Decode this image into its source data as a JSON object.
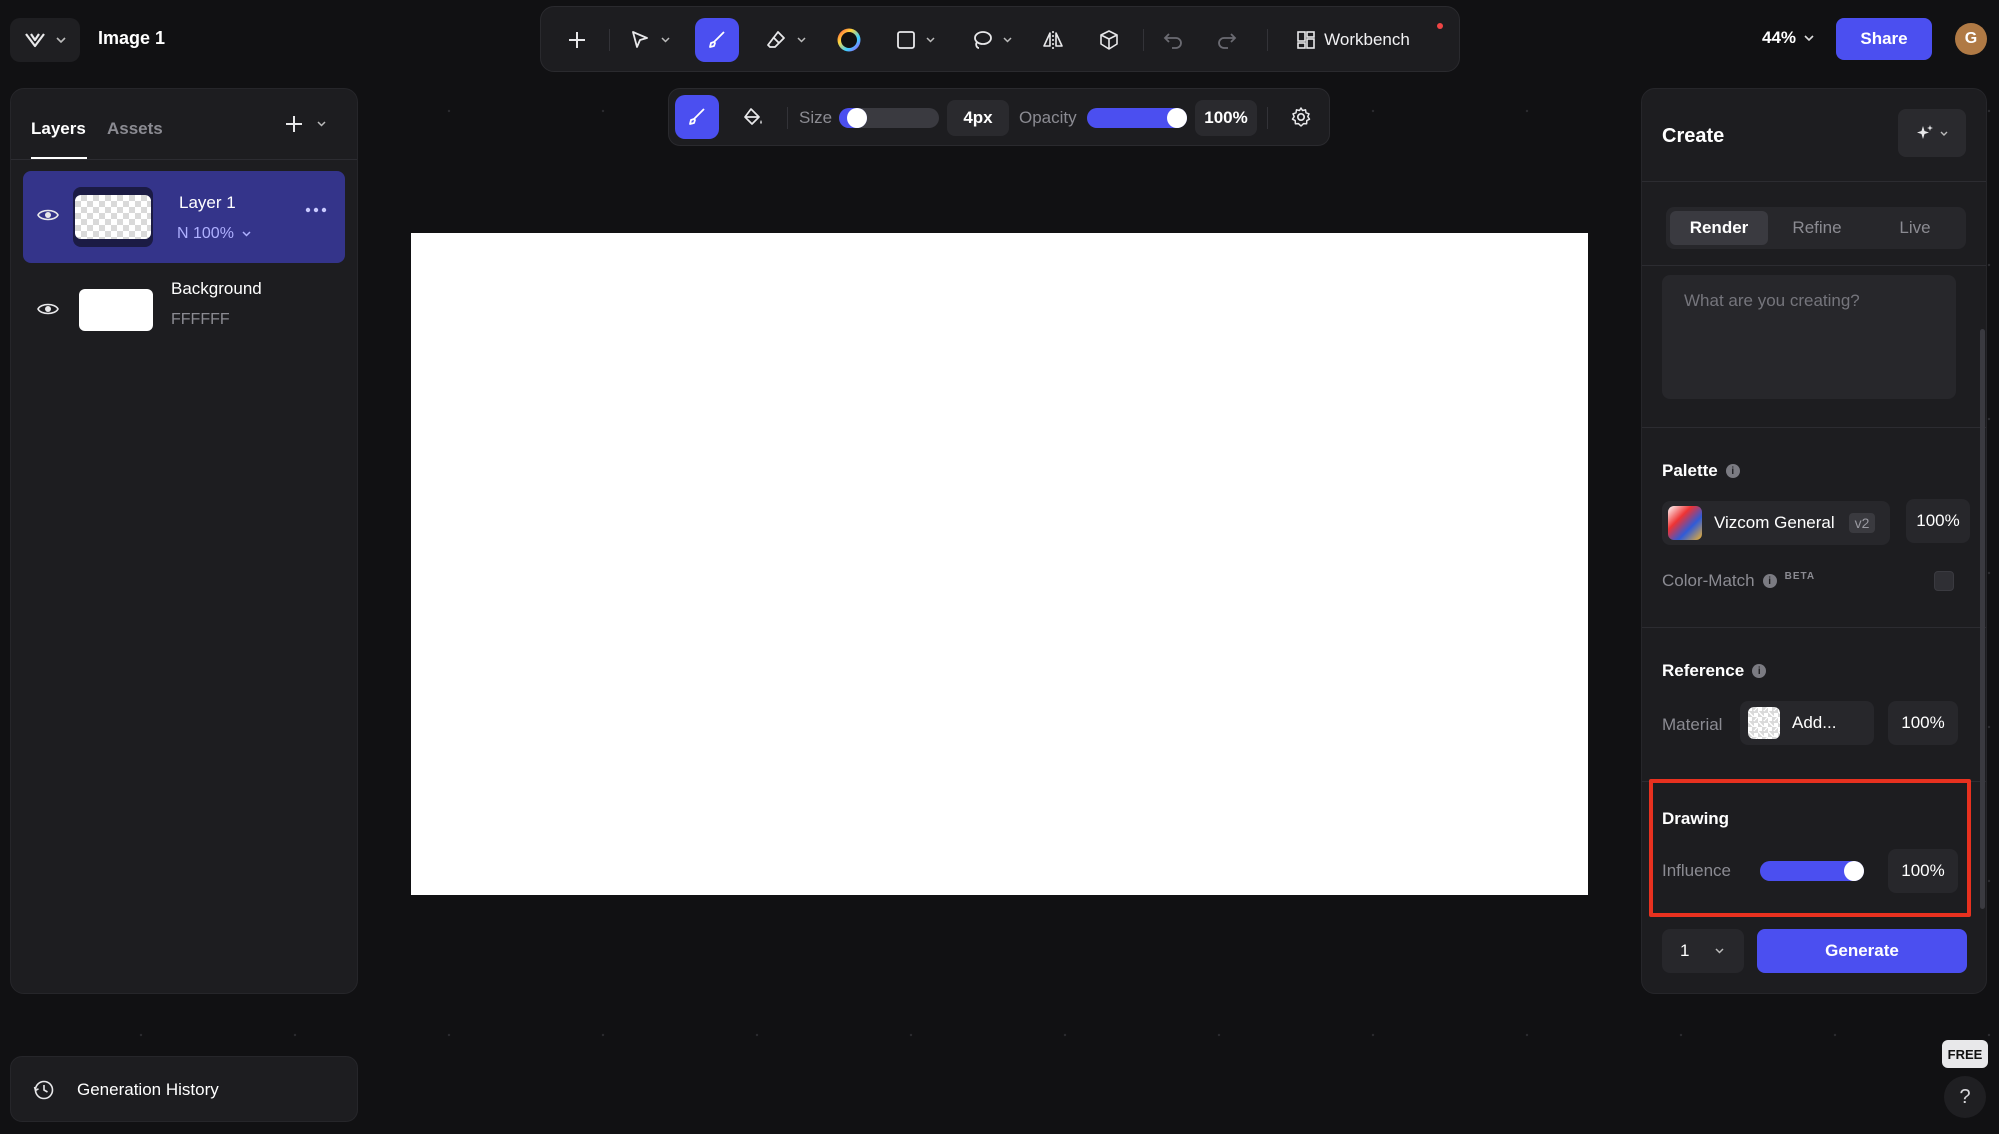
{
  "document": {
    "title": "Image 1",
    "zoom": "44%"
  },
  "header": {
    "share_label": "Share",
    "avatar_initial": "G"
  },
  "toolbar": {
    "workbench_label": "Workbench"
  },
  "brush_options": {
    "size_label": "Size",
    "size_value": "4px",
    "size_level": 0.1,
    "opacity_label": "Opacity",
    "opacity_value": "100%",
    "opacity_level": 1.0
  },
  "left_panel": {
    "tabs": [
      {
        "label": "Layers",
        "active": true
      },
      {
        "label": "Assets",
        "active": false
      }
    ],
    "layers": [
      {
        "name": "Layer 1",
        "sub": "N 100%",
        "selected": true
      },
      {
        "name": "Background",
        "sub": "FFFFFF",
        "selected": false
      }
    ],
    "history_label": "Generation History"
  },
  "right_panel": {
    "title": "Create",
    "modes": [
      {
        "label": "Render",
        "active": true
      },
      {
        "label": "Refine",
        "active": false
      },
      {
        "label": "Live",
        "active": false
      }
    ],
    "prompt_placeholder": "What are you creating?",
    "palette": {
      "title": "Palette",
      "name": "Vizcom General",
      "version": "v2",
      "strength": "100%",
      "color_match_label": "Color-Match",
      "beta_label": "BETA",
      "color_match_enabled": false
    },
    "reference": {
      "title": "Reference",
      "material_label": "Material",
      "add_label": "Add...",
      "strength": "100%"
    },
    "drawing": {
      "title": "Drawing",
      "influence_label": "Influence",
      "influence_value": "100%",
      "influence_level": 1.0
    },
    "count_value": "1",
    "generate_label": "Generate"
  },
  "corner": {
    "free_badge": "FREE",
    "help_label": "?"
  },
  "colors": {
    "accent": "#4b4ff0",
    "highlight": "#e8311f",
    "panel": "#1d1d20",
    "background": "#111113"
  }
}
